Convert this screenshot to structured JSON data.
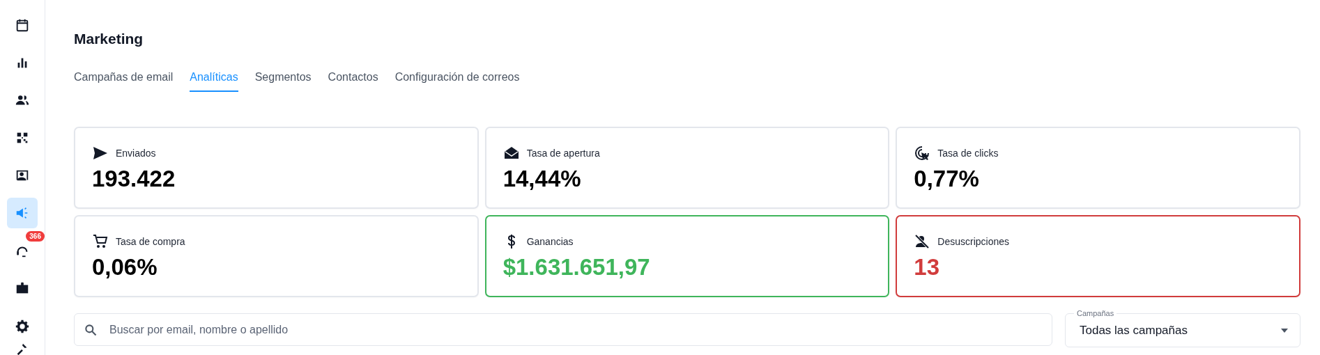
{
  "sidebar": {
    "items": [
      {
        "selected": false
      },
      {
        "selected": false
      },
      {
        "selected": false
      },
      {
        "selected": false
      },
      {
        "selected": false
      },
      {
        "selected": true
      },
      {
        "selected": false,
        "badge": "366"
      },
      {
        "selected": false
      }
    ],
    "bottom_items": [
      {
        "selected": false
      },
      {
        "selected": false
      }
    ]
  },
  "page": {
    "title": "Marketing"
  },
  "tabs": [
    {
      "label": "Campañas de email",
      "selected": false
    },
    {
      "label": "Analíticas",
      "selected": true
    },
    {
      "label": "Segmentos",
      "selected": false
    },
    {
      "label": "Contactos",
      "selected": false
    },
    {
      "label": "Configuración de correos",
      "selected": false
    }
  ],
  "stats": [
    {
      "label": "Enviados",
      "value": "193.422"
    },
    {
      "label": "Tasa de apertura",
      "value": "14,44%"
    },
    {
      "label": "Tasa de clicks",
      "value": "0,77%"
    },
    {
      "label": "Tasa de compra",
      "value": "0,06%"
    },
    {
      "label": "Ganancias",
      "value": "$1.631.651,97",
      "color": "#3fb55b"
    },
    {
      "label": "Desuscripciones",
      "value": "13",
      "color": "#d13c3c"
    }
  ],
  "search": {
    "placeholder": "Buscar por email, nombre o apellido"
  },
  "campaign_select": {
    "label": "Campañas",
    "value": "Todas las campañas"
  }
}
